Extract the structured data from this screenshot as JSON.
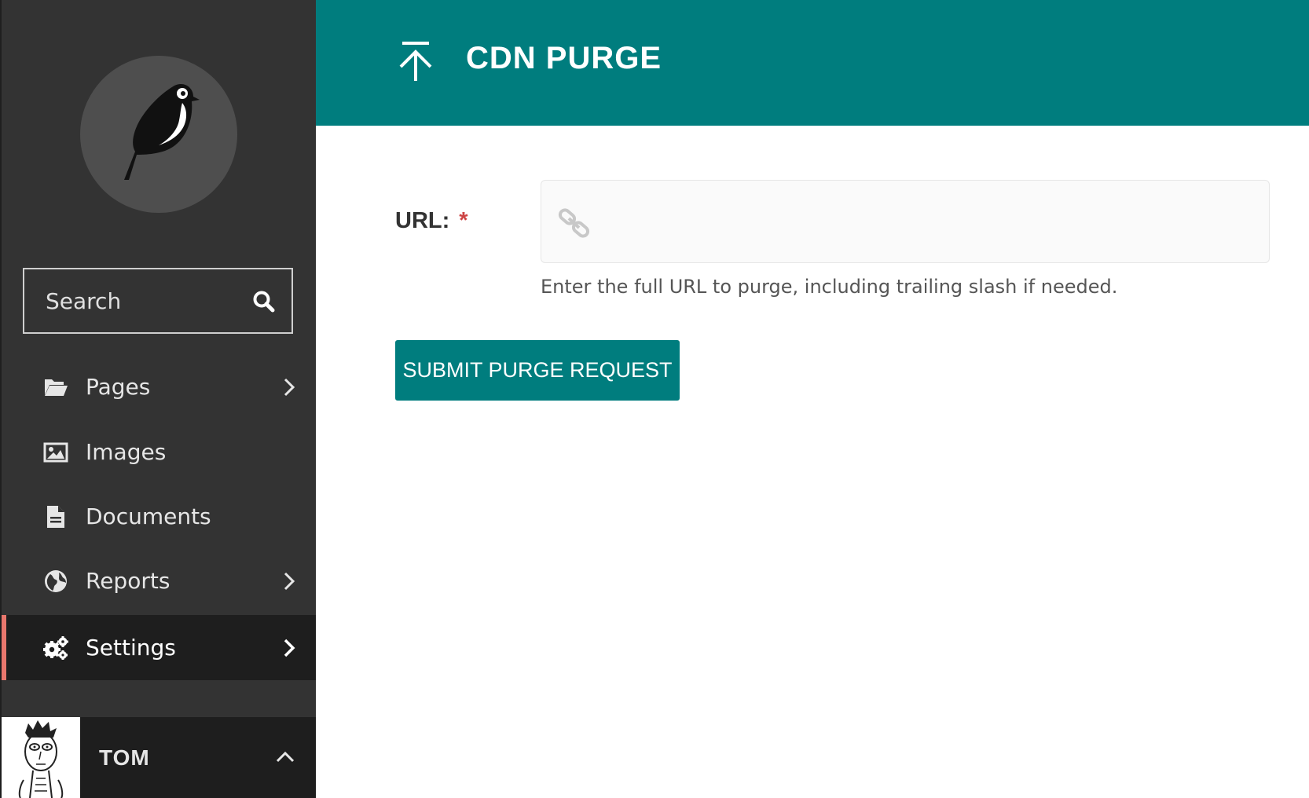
{
  "sidebar": {
    "logo_icon": "wagtail-bird-icon",
    "search": {
      "placeholder": "Search",
      "icon": "search-icon"
    },
    "items": [
      {
        "label": "Pages",
        "icon": "folder-open-icon",
        "has_submenu": true
      },
      {
        "label": "Images",
        "icon": "image-icon",
        "has_submenu": false
      },
      {
        "label": "Documents",
        "icon": "document-icon",
        "has_submenu": false
      },
      {
        "label": "Reports",
        "icon": "globe-icon",
        "has_submenu": true
      },
      {
        "label": "Settings",
        "icon": "cogs-icon",
        "has_submenu": true,
        "active": true
      }
    ],
    "account": {
      "name": "TOM",
      "toggle_icon": "chevron-up-icon"
    }
  },
  "header": {
    "title": "CDN PURGE",
    "icon": "upload-arrow-icon"
  },
  "form": {
    "url_label": "URL:",
    "required_mark": "*",
    "url_value": "",
    "url_icon": "link-icon",
    "help_text": "Enter the full URL to purge, including trailing slash if needed.",
    "submit_label": "SUBMIT PURGE REQUEST"
  },
  "colors": {
    "primary_teal": "#007d7e",
    "sidebar_bg": "#333333",
    "active_item_bg": "#1e1e1e",
    "active_indicator": "#e9776d",
    "required_red": "#cd4444"
  }
}
